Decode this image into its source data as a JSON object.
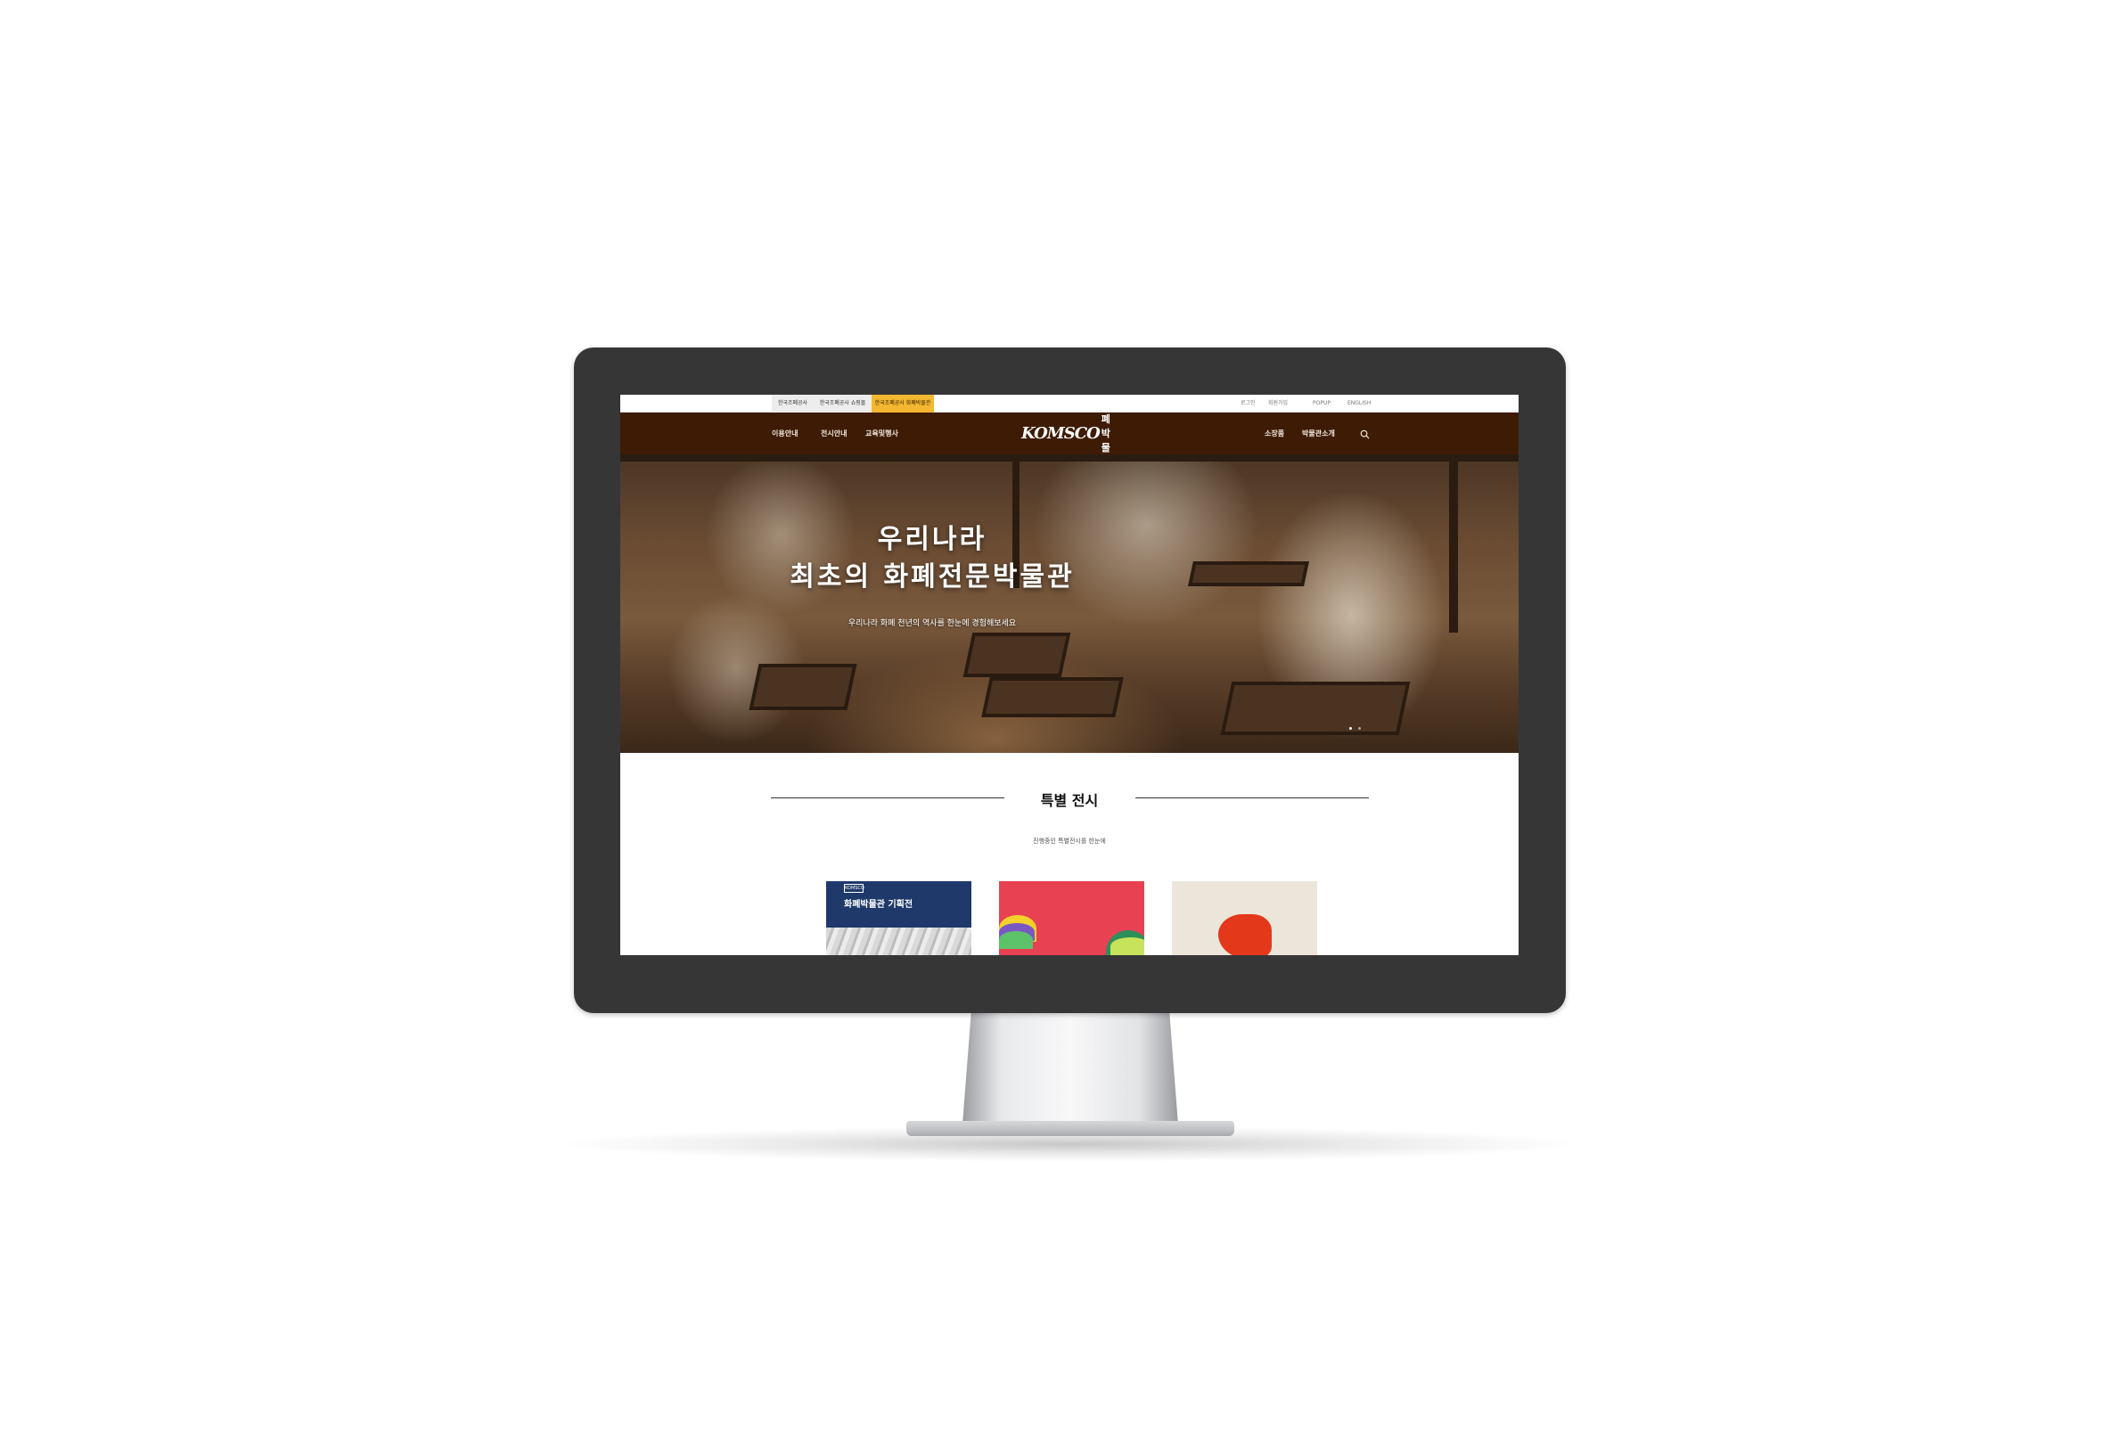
{
  "family_tabs": [
    {
      "label": "한국조폐공사",
      "active": false
    },
    {
      "label": "한국조폐공사 쇼핑몰",
      "active": false
    },
    {
      "label": "한국조폐공사 화폐박물관",
      "active": true
    }
  ],
  "utility_links": [
    "로그인",
    "회원가입",
    "POPUP",
    "ENGLISH"
  ],
  "nav_left": [
    "이용안내",
    "전시안내",
    "교육및행사"
  ],
  "nav_right": [
    "소장품",
    "박물관소개"
  ],
  "logo": {
    "mark": "KOMSCO",
    "text": "화폐박물관"
  },
  "hero": {
    "title_line1": "우리나라",
    "title_line2": "최초의 화폐전문박물관",
    "subtitle": "우리나라 화폐 천년의 역사를 한눈에 경험해보세요",
    "slide_count": 2,
    "active_slide": 1
  },
  "section": {
    "title": "특별 전시",
    "subtitle": "진행중인 특별전시를 한눈에"
  },
  "cards": [
    {
      "badge": "KOMSCO",
      "title": "화폐박물관 기획전",
      "bg": "#1f3a6a"
    },
    {
      "title": "",
      "bg": "#e84152"
    },
    {
      "title": "",
      "bg": "#ece6da"
    }
  ],
  "colors": {
    "nav_bg": "#3e1b05",
    "active_tab": "#f3b731",
    "bezel": "#363636"
  }
}
